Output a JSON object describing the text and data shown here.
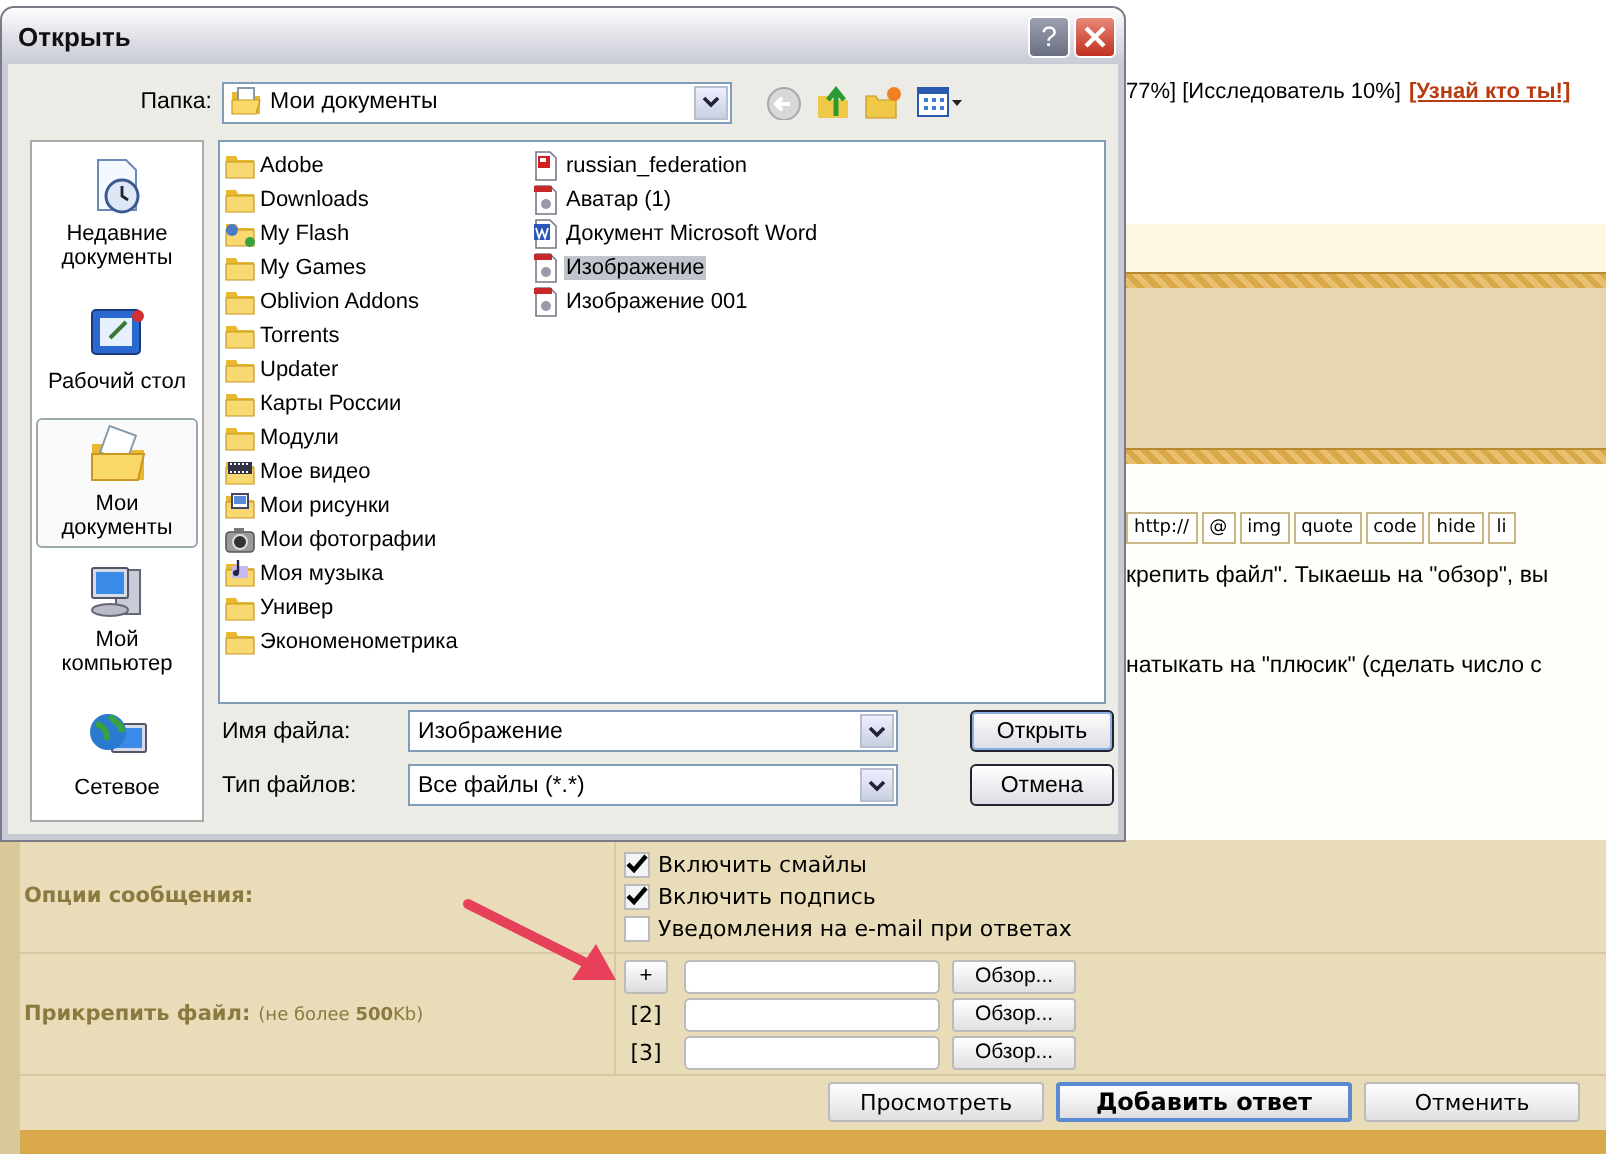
{
  "page": {
    "rank_text": "77%] [Исследователь 10%]",
    "rank_link": "[Узнай кто ты!]",
    "toolbar": [
      "http://",
      "@",
      "img",
      "quote",
      "code",
      "hide",
      "li"
    ],
    "message_lines": [
      "крепить файл\". Тыкаешь на \"обзор\", вы",
      "натыкать на \"плюсик\" (сделать число с"
    ],
    "options": {
      "label": "Опции сообщения:",
      "checkboxes": [
        {
          "label": "Включить смайлы",
          "checked": true
        },
        {
          "label": "Включить подпись",
          "checked": true
        },
        {
          "label": "Уведомления на e-mail при ответах",
          "checked": false
        }
      ]
    },
    "attach": {
      "label": "Прикрепить файл:",
      "note": "(не более **500**Kb)",
      "rows": [
        {
          "kind": "button",
          "marker": "+",
          "browse": "Обзор..."
        },
        {
          "kind": "index",
          "marker": "[2]",
          "browse": "Обзор..."
        },
        {
          "kind": "index",
          "marker": "[3]",
          "browse": "Обзор..."
        }
      ]
    },
    "buttons": [
      {
        "label": "Просмотреть",
        "default": false
      },
      {
        "label": "Добавить ответ",
        "default": true
      },
      {
        "label": "Отменить",
        "default": false
      }
    ]
  },
  "dialog": {
    "title": "Открыть",
    "help_button": "?",
    "folder_label": "Папка:",
    "folder": "Мои документы",
    "places": [
      {
        "kind": "recent",
        "label": "Недавние документы",
        "selected": false
      },
      {
        "kind": "desktop",
        "label": "Рабочий стол",
        "selected": false
      },
      {
        "kind": "documents",
        "label": "Мои документы",
        "selected": true
      },
      {
        "kind": "computer",
        "label": "Мой компьютер",
        "selected": false
      },
      {
        "kind": "network",
        "label": "Сетевое",
        "selected": false
      }
    ],
    "files": [
      {
        "kind": "folder",
        "name": "Adobe",
        "selected": false
      },
      {
        "kind": "folder",
        "name": "Downloads",
        "selected": false
      },
      {
        "kind": "shared",
        "name": "My Flash",
        "selected": false
      },
      {
        "kind": "folder",
        "name": "My Games",
        "selected": false
      },
      {
        "kind": "folder",
        "name": "Oblivion Addons",
        "selected": false
      },
      {
        "kind": "folder",
        "name": "Torrents",
        "selected": false
      },
      {
        "kind": "folder",
        "name": "Updater",
        "selected": false
      },
      {
        "kind": "folder",
        "name": "Карты России",
        "selected": false
      },
      {
        "kind": "folder",
        "name": "Модули",
        "selected": false
      },
      {
        "kind": "video",
        "name": "Мое видео",
        "selected": false
      },
      {
        "kind": "pictures",
        "name": "Мои рисунки",
        "selected": false
      },
      {
        "kind": "camera",
        "name": "Мои фотографии",
        "selected": false
      },
      {
        "kind": "music",
        "name": "Моя музыка",
        "selected": false
      },
      {
        "kind": "folder",
        "name": "Универ",
        "selected": false
      },
      {
        "kind": "folder",
        "name": "Экономенометрика",
        "selected": false
      },
      {
        "kind": "image",
        "name": "russian_federation",
        "selected": false
      },
      {
        "kind": "document",
        "name": "Аватар (1)",
        "selected": false
      },
      {
        "kind": "word",
        "name": "Документ Microsoft Word",
        "selected": false
      },
      {
        "kind": "document",
        "name": "Изображение",
        "selected": true
      },
      {
        "kind": "document",
        "name": "Изображение 001",
        "selected": false
      }
    ],
    "filename_label": "Имя файла:",
    "filename": "Изображение",
    "filetype_label": "Тип файлов:",
    "filetype": "Все файлы (*.*)",
    "buttons": [
      {
        "label": "Открыть",
        "default": true
      },
      {
        "label": "Отмена",
        "default": false
      }
    ]
  }
}
